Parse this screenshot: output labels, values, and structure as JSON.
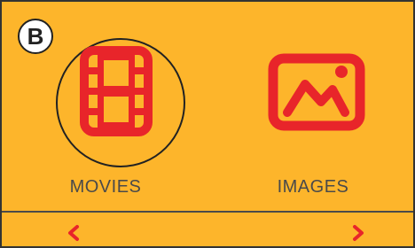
{
  "panel": {
    "badge": "B",
    "background_color": "#fdb52b",
    "accent_color": "#e8252a",
    "text_color": "#4a4a4a"
  },
  "tiles": [
    {
      "label": "MOVIES",
      "icon": "film-strip-icon",
      "focused": true
    },
    {
      "label": "IMAGES",
      "icon": "image-icon",
      "focused": false
    }
  ],
  "navigation": {
    "previous_icon": "chevron-left-icon",
    "next_icon": "chevron-right-icon"
  }
}
